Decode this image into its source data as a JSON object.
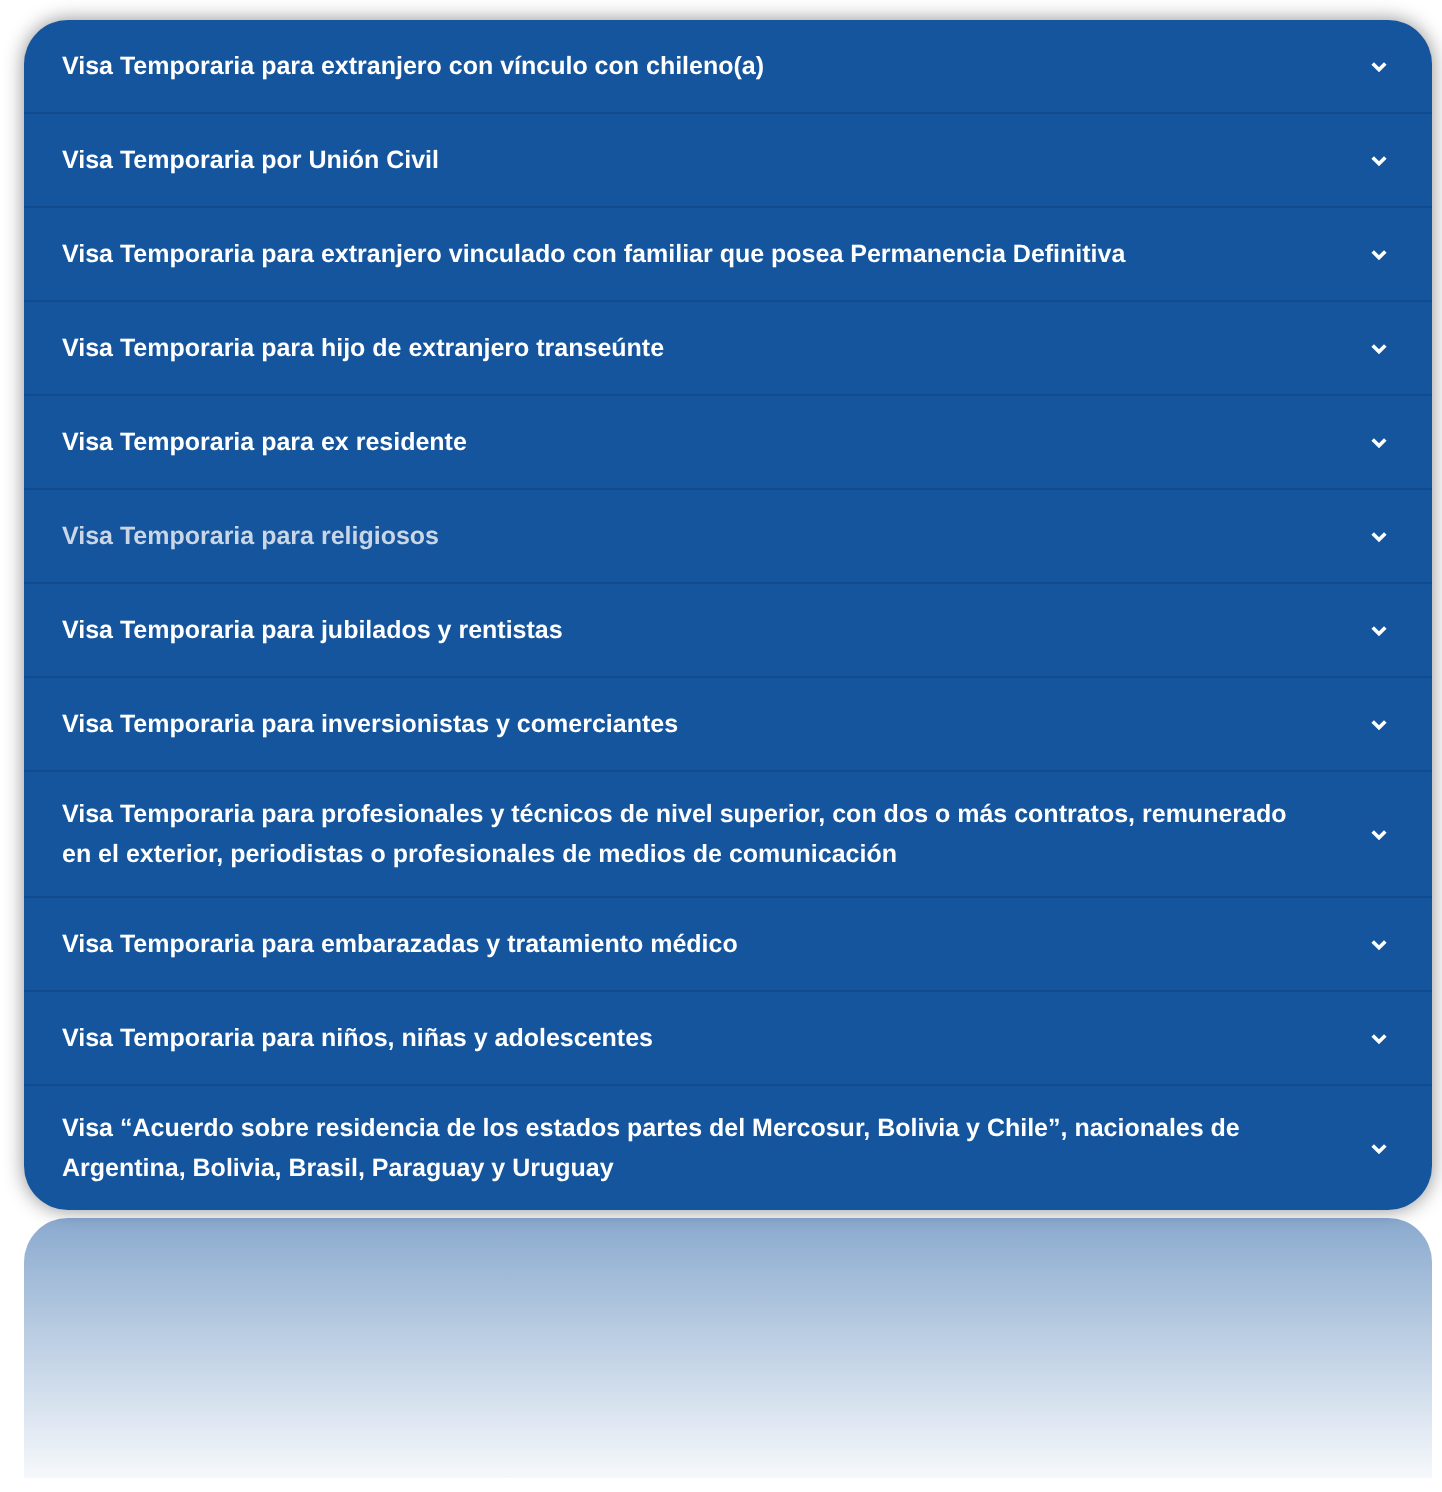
{
  "accordion": {
    "items": [
      {
        "title": "Visa Temporaria para extranjero con vínculo con chileno(a)",
        "highlighted": false
      },
      {
        "title": "Visa Temporaria por Unión Civil",
        "highlighted": false
      },
      {
        "title": "Visa Temporaria para extranjero vinculado con familiar que posea Permanencia Definitiva",
        "highlighted": false
      },
      {
        "title": "Visa Temporaria para hijo de extranjero transeúnte",
        "highlighted": false
      },
      {
        "title": "Visa Temporaria para ex residente",
        "highlighted": false
      },
      {
        "title": "Visa Temporaria para religiosos",
        "highlighted": true
      },
      {
        "title": "Visa Temporaria para jubilados y rentistas",
        "highlighted": false
      },
      {
        "title": "Visa Temporaria para inversionistas y comerciantes",
        "highlighted": false
      },
      {
        "title": "Visa Temporaria para profesionales y técnicos de nivel superior, con dos o más contratos, remunerado en el exterior, periodistas o profesionales de medios de comunicación",
        "highlighted": false
      },
      {
        "title": "Visa Temporaria para embarazadas y tratamiento médico",
        "highlighted": false
      },
      {
        "title": "Visa Temporaria para niños, niñas y adolescentes",
        "highlighted": false
      },
      {
        "title": "Visa “Acuerdo sobre residencia de los estados partes del Mercosur, Bolivia y Chile”, nacionales de Argentina, Bolivia, Brasil, Paraguay y Uruguay",
        "highlighted": false
      }
    ]
  }
}
